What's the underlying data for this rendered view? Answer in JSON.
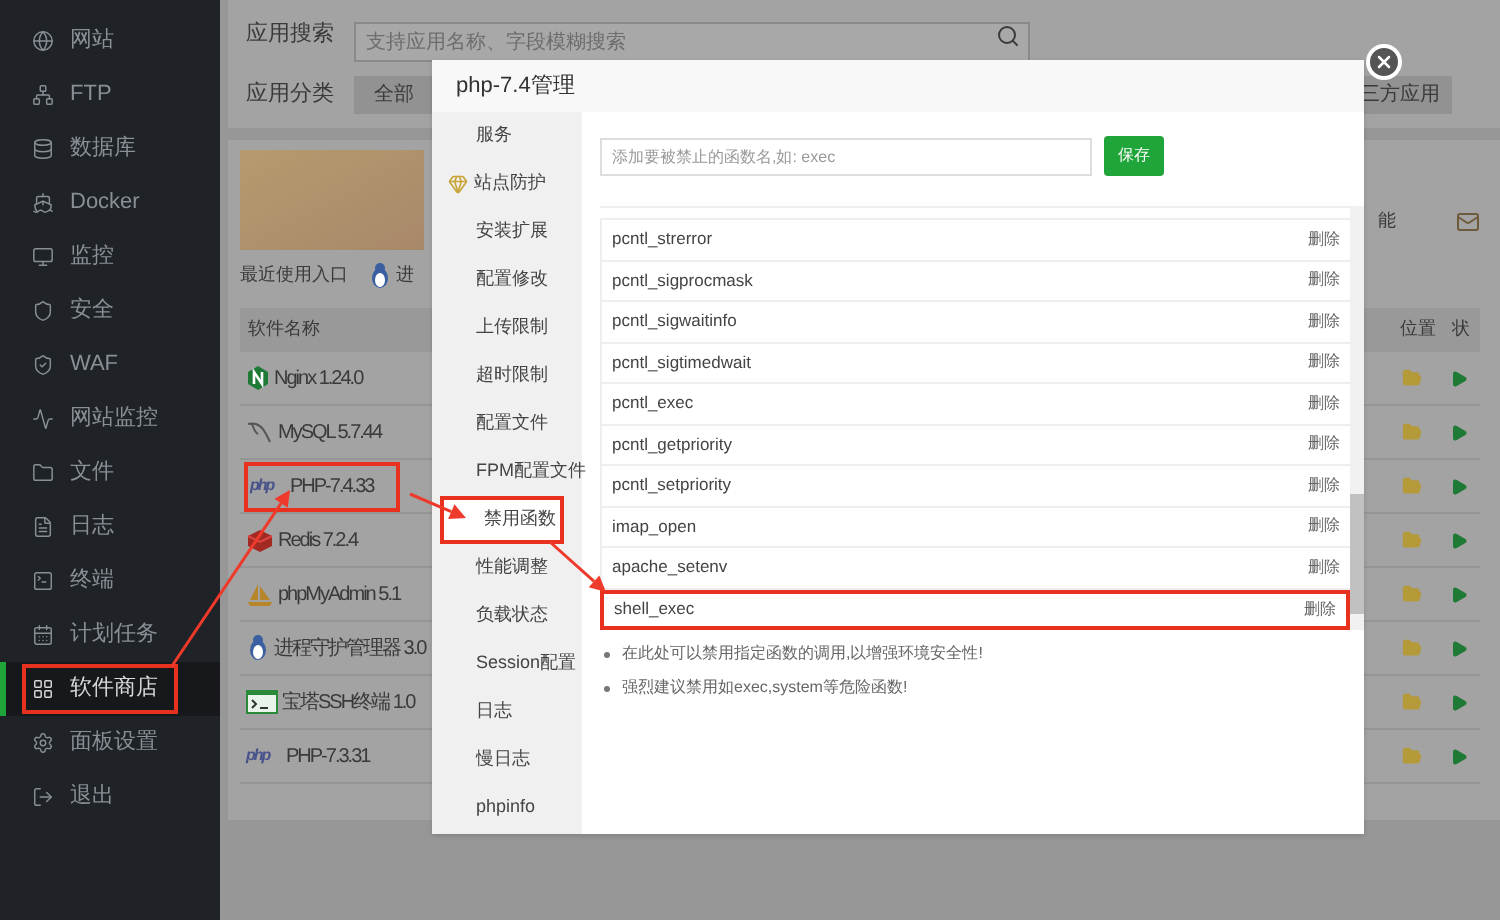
{
  "sidebar": {
    "items": [
      {
        "label": "网站",
        "kind": "globe",
        "selected": false,
        "highlighted": false
      },
      {
        "label": "FTP",
        "kind": "ftp",
        "selected": false,
        "highlighted": false
      },
      {
        "label": "数据库",
        "kind": "database",
        "selected": false,
        "highlighted": false
      },
      {
        "label": "Docker",
        "kind": "docker",
        "selected": false,
        "highlighted": false
      },
      {
        "label": "监控",
        "kind": "monitor",
        "selected": false,
        "highlighted": false
      },
      {
        "label": "安全",
        "kind": "shield",
        "selected": false,
        "highlighted": false
      },
      {
        "label": "WAF",
        "kind": "waf",
        "selected": false,
        "highlighted": false
      },
      {
        "label": "网站监控",
        "kind": "chart",
        "selected": false,
        "highlighted": false
      },
      {
        "label": "文件",
        "kind": "folder",
        "selected": false,
        "highlighted": false
      },
      {
        "label": "日志",
        "kind": "log",
        "selected": false,
        "highlighted": false
      },
      {
        "label": "终端",
        "kind": "terminal",
        "selected": false,
        "highlighted": false
      },
      {
        "label": "计划任务",
        "kind": "calendar",
        "selected": false,
        "highlighted": false
      },
      {
        "label": "软件商店",
        "kind": "store",
        "selected": true,
        "highlighted": true
      },
      {
        "label": "面板设置",
        "kind": "settings",
        "selected": false,
        "highlighted": false
      },
      {
        "label": "退出",
        "kind": "logout",
        "selected": false,
        "highlighted": false
      }
    ]
  },
  "search": {
    "label": "应用搜索",
    "placeholder": "支持应用名称、字段模糊搜索"
  },
  "categories": {
    "label": "应用分类",
    "items": [
      "全部",
      "三方应用"
    ]
  },
  "banner": {
    "side_text": "能"
  },
  "recent": {
    "label": "最近使用入口",
    "items": [
      "进"
    ]
  },
  "software": {
    "columns": [
      "软件名称",
      "位置",
      "状"
    ],
    "rows": [
      {
        "name": "Nginx 1.24.0",
        "kind": "nginx",
        "highlighted": false
      },
      {
        "name": "MySQL 5.7.44",
        "kind": "mysql",
        "highlighted": false
      },
      {
        "name": "PHP-7.4.33",
        "kind": "php",
        "logo": "php",
        "highlighted": true
      },
      {
        "name": "Redis 7.2.4",
        "kind": "redis",
        "highlighted": false
      },
      {
        "name": "phpMyAdmin 5.1",
        "kind": "boat",
        "highlighted": false
      },
      {
        "name": "进程守护管理器 3.0",
        "kind": "penguin",
        "highlighted": false
      },
      {
        "name": "宝塔SSH终端 1.0",
        "kind": "terminal",
        "highlighted": false
      },
      {
        "name": "PHP-7.3.31",
        "kind": "php",
        "logo": "php",
        "highlighted": false
      }
    ]
  },
  "dialog": {
    "title": "php-7.4管理",
    "menu": [
      {
        "label": "服务",
        "selected": false,
        "highlighted": false
      },
      {
        "label": "站点防护",
        "kind": "gem",
        "selected": false,
        "highlighted": false
      },
      {
        "label": "安装扩展",
        "selected": false,
        "highlighted": false
      },
      {
        "label": "配置修改",
        "selected": false,
        "highlighted": false
      },
      {
        "label": "上传限制",
        "selected": false,
        "highlighted": false
      },
      {
        "label": "超时限制",
        "selected": false,
        "highlighted": false
      },
      {
        "label": "配置文件",
        "selected": false,
        "highlighted": false
      },
      {
        "label": "FPM配置文件",
        "selected": false,
        "highlighted": false
      },
      {
        "label": "禁用函数",
        "selected": true,
        "highlighted": true
      },
      {
        "label": "性能调整",
        "selected": false,
        "highlighted": false
      },
      {
        "label": "负载状态",
        "selected": false,
        "highlighted": false
      },
      {
        "label": "Session配置",
        "selected": false,
        "highlighted": false
      },
      {
        "label": "日志",
        "selected": false,
        "highlighted": false
      },
      {
        "label": "慢日志",
        "selected": false,
        "highlighted": false
      },
      {
        "label": "phpinfo",
        "selected": false,
        "highlighted": false
      }
    ],
    "input": {
      "placeholder": "添加要被禁止的函数名,如: exec"
    },
    "save_button": "保存",
    "functions": [
      {
        "name": "pcntl_strerror",
        "action": "删除",
        "highlighted": false
      },
      {
        "name": "pcntl_sigprocmask",
        "action": "删除",
        "highlighted": false
      },
      {
        "name": "pcntl_sigwaitinfo",
        "action": "删除",
        "highlighted": false
      },
      {
        "name": "pcntl_sigtimedwait",
        "action": "删除",
        "highlighted": false
      },
      {
        "name": "pcntl_exec",
        "action": "删除",
        "highlighted": false
      },
      {
        "name": "pcntl_getpriority",
        "action": "删除",
        "highlighted": false
      },
      {
        "name": "pcntl_setpriority",
        "action": "删除",
        "highlighted": false
      },
      {
        "name": "imap_open",
        "action": "删除",
        "highlighted": false
      },
      {
        "name": "apache_setenv",
        "action": "删除",
        "highlighted": false
      },
      {
        "name": "shell_exec",
        "action": "删除",
        "highlighted": true
      }
    ],
    "notes": [
      "在此处可以禁用指定函数的调用,以增强环境安全性!",
      "强烈建议禁用如exec,system等危险函数!"
    ]
  }
}
